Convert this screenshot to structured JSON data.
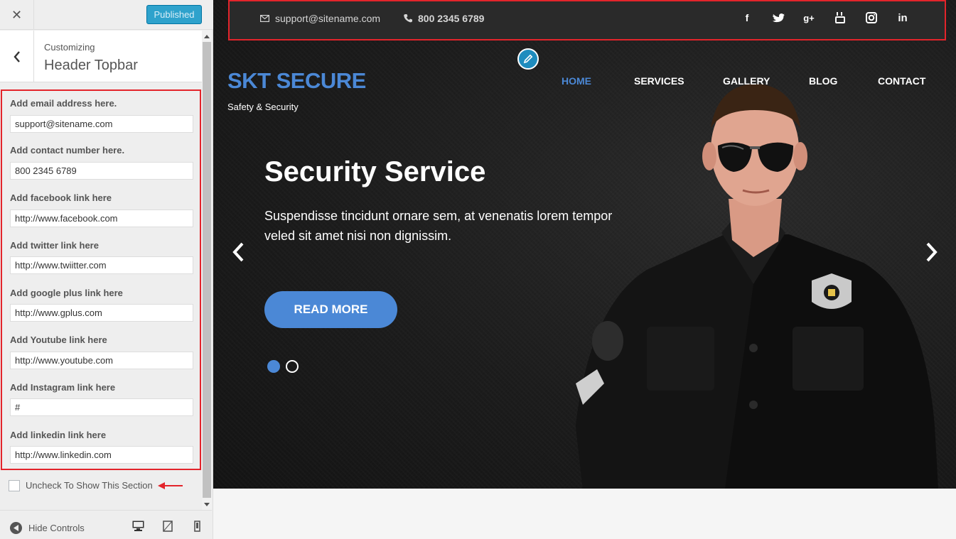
{
  "customizer": {
    "close_glyph": "✕",
    "publish_label": "Published",
    "breadcrumb": "Customizing",
    "section_title": "Header Topbar",
    "fields": [
      {
        "label": "Add email address here.",
        "value": "support@sitename.com"
      },
      {
        "label": "Add contact number here.",
        "value": "800 2345 6789"
      },
      {
        "label": "Add facebook link here",
        "value": "http://www.facebook.com"
      },
      {
        "label": "Add twitter link here",
        "value": "http://www.twiitter.com"
      },
      {
        "label": "Add google plus link here",
        "value": "http://www.gplus.com"
      },
      {
        "label": "Add Youtube link here",
        "value": "http://www.youtube.com"
      },
      {
        "label": "Add Instagram link here",
        "value": "#"
      },
      {
        "label": "Add linkedin link here",
        "value": "http://www.linkedin.com"
      }
    ],
    "checkbox_label": "Uncheck To Show This Section",
    "hide_controls_label": "Hide Controls",
    "colors": {
      "publish": "#2ea2cc",
      "highlight": "#e3242b"
    }
  },
  "site": {
    "topbar": {
      "email": "support@sitename.com",
      "phone": "800 2345 6789",
      "social_icons": [
        "facebook-icon",
        "twitter-icon",
        "google-plus-icon",
        "youtube-icon",
        "instagram-icon",
        "linkedin-icon"
      ]
    },
    "logo": "SKT SECURE",
    "tagline": "Safety & Security",
    "nav": [
      "HOME",
      "SERVICES",
      "GALLERY",
      "BLOG",
      "CONTACT"
    ],
    "slide": {
      "title": "Security Service",
      "text": "Suspendisse tincidunt ornare sem, at venenatis lorem tempor veled sit amet nisi non dignissim.",
      "button": "READ MORE"
    },
    "colors": {
      "accent": "#4b88d6"
    }
  }
}
